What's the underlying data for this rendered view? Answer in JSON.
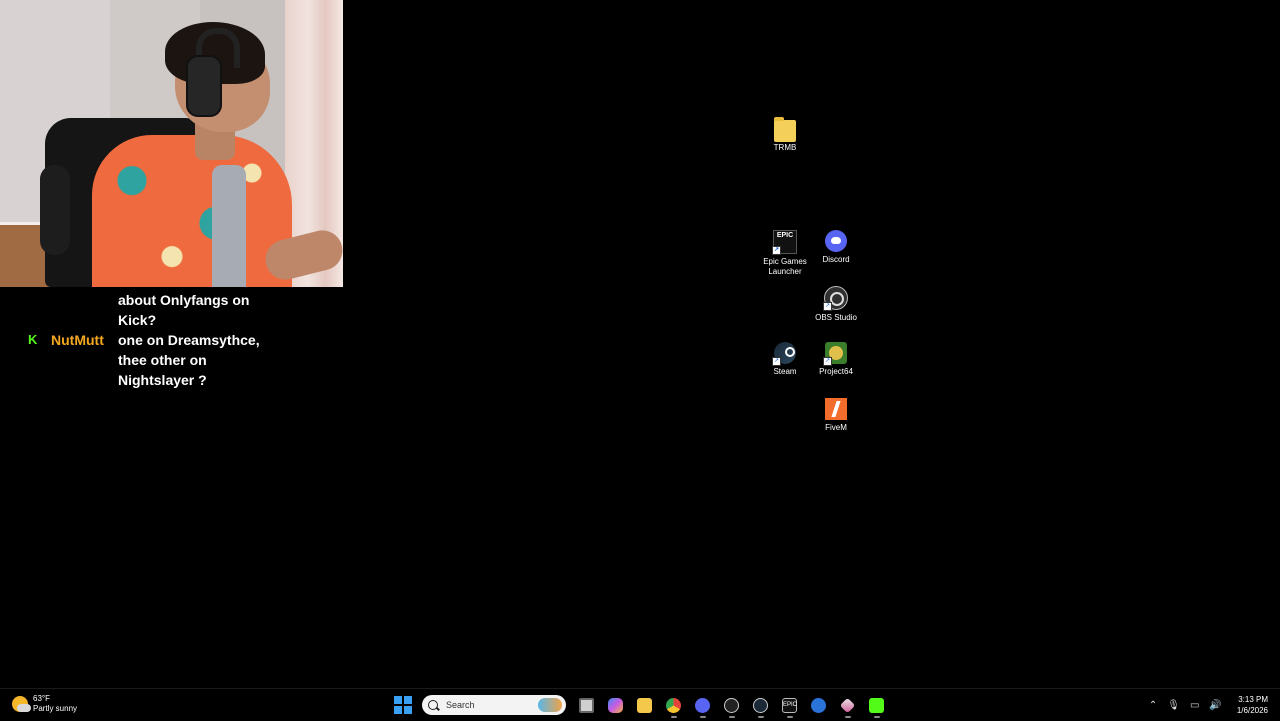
{
  "chat": {
    "partial_message": "about Onlyfangs on Kick?",
    "partial_lines": [
      "about Onlyfangs on",
      "Kick?"
    ],
    "platform_badge": "K",
    "username": "NutMutt",
    "message_lines": [
      "one on Dreamsythce,",
      "thee other on",
      "Nightslayer ?"
    ]
  },
  "desktop": {
    "icons": [
      {
        "label": "TRMB",
        "icon": "folder-icon"
      },
      {
        "label_lines": [
          "Epic Games",
          "Launcher"
        ],
        "icon": "epic-games-icon",
        "glyph": "EPIC"
      },
      {
        "label": "Discord",
        "icon": "discord-icon"
      },
      {
        "label": "OBS Studio",
        "icon": "obs-icon"
      },
      {
        "label": "Steam",
        "icon": "steam-icon"
      },
      {
        "label": "Project64",
        "icon": "project64-icon"
      },
      {
        "label": "FiveM",
        "icon": "fivem-icon"
      }
    ]
  },
  "taskbar": {
    "weather": {
      "temp": "63°F",
      "condition": "Partly sunny"
    },
    "search_placeholder": "Search",
    "epic_glyph": "EPIC",
    "clock": {
      "time": "3:13 PM",
      "date": "1/6/2026"
    }
  },
  "colors": {
    "desktop_bg": "#000000",
    "kick_green": "#53fc18",
    "username": "#f5a623"
  }
}
